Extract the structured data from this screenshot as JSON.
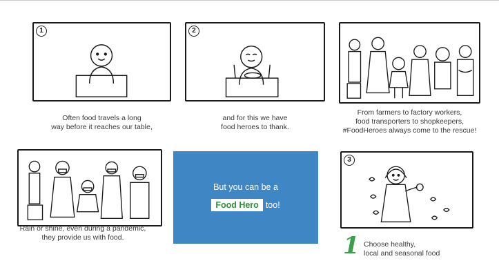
{
  "panels": [
    {
      "number": "1",
      "caption": [
        "Often food travels a long",
        "way before it reaches our table,"
      ]
    },
    {
      "number": "2",
      "caption": [
        "and for this we have",
        "food heroes to thank."
      ]
    },
    {
      "number": "",
      "caption": [
        "From farmers to factory workers,",
        "food transporters to shopkeepers,",
        "#FoodHeroes always come to the rescue!"
      ]
    },
    {
      "number": "",
      "caption": [
        "Rain or shine, even during a pandemic,",
        "they provide us with food."
      ]
    },
    {
      "number": "3",
      "caption": []
    }
  ],
  "promo": {
    "line1": "But you can be a",
    "badge": "Food Hero",
    "suffix": "too!",
    "background": "#3e86c4",
    "badge_color": "#2f8f3c"
  },
  "tip": {
    "number": "1",
    "lines": [
      "Choose healthy,",
      "local and seasonal food"
    ],
    "color": "#3aa14a"
  }
}
